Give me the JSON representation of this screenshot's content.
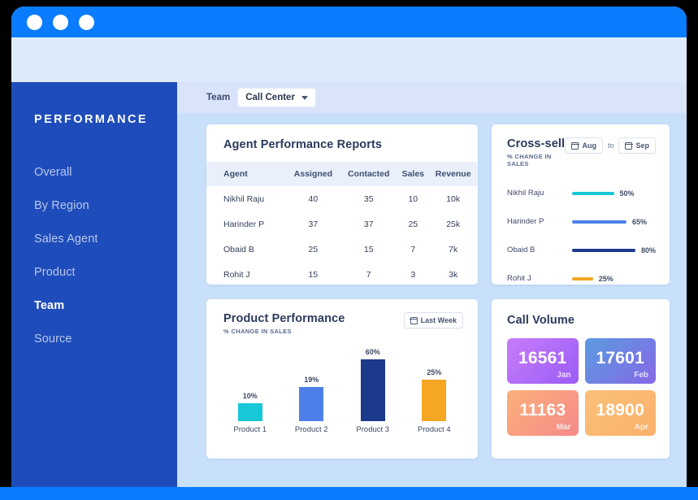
{
  "window": {
    "traffic_lights": [
      "dot-1",
      "dot-2",
      "dot-3"
    ]
  },
  "sidebar": {
    "brand": "PERFORMANCE",
    "items": [
      {
        "label": "Overall",
        "active": false
      },
      {
        "label": "By Region",
        "active": false
      },
      {
        "label": "Sales Agent",
        "active": false
      },
      {
        "label": "Product",
        "active": false
      },
      {
        "label": "Team",
        "active": true
      },
      {
        "label": "Source",
        "active": false
      }
    ]
  },
  "topbar": {
    "label": "Team",
    "select_value": "Call Center"
  },
  "agent_reports": {
    "title": "Agent Performance Reports",
    "columns": [
      "Agent",
      "Assigned",
      "Contacted",
      "Sales",
      "Revenue"
    ],
    "rows": [
      [
        "Nikhil Raju",
        "40",
        "35",
        "10",
        "10k"
      ],
      [
        "Harinder P",
        "37",
        "37",
        "25",
        "25k"
      ],
      [
        "Obaid B",
        "25",
        "15",
        "7",
        "7k"
      ],
      [
        "Rohit J",
        "15",
        "7",
        "3",
        "3k"
      ]
    ]
  },
  "cross_sell": {
    "title": "Cross-sell",
    "subtitle": "% CHANGE IN SALES",
    "range_from": "Aug",
    "range_to_label": "to",
    "range_to": "Sep",
    "chart_data": {
      "type": "bar",
      "orientation": "horizontal",
      "title": "Cross-sell",
      "xlabel": "% change in sales",
      "ylabel": "",
      "categories": [
        "Nikhil Raju",
        "Harinder P",
        "Obaid B",
        "Rohit J"
      ],
      "values": [
        50,
        65,
        80,
        25
      ],
      "labels": [
        "50%",
        "65%",
        "80%",
        "25%"
      ],
      "colors": [
        "#16c8d8",
        "#4e7fe8",
        "#1b3a8c",
        "#f5a623"
      ],
      "xlim": [
        0,
        100
      ],
      "grid": false,
      "legend": "none"
    }
  },
  "product_performance": {
    "title": "Product Performance",
    "subtitle": "% CHANGE IN SALES",
    "range_label": "Last Week",
    "chart_data": {
      "type": "bar",
      "orientation": "vertical",
      "title": "Product Performance",
      "xlabel": "",
      "ylabel": "% change in sales",
      "categories": [
        "Product 1",
        "Product 2",
        "Product 3",
        "Product 4"
      ],
      "values": [
        10,
        19,
        60,
        25
      ],
      "labels": [
        "10%",
        "19%",
        "60%",
        "25%"
      ],
      "colors": [
        "#16c8d8",
        "#4e7fe8",
        "#1b3a8c",
        "#f5a623"
      ],
      "ylim": [
        0,
        70
      ],
      "grid": false,
      "legend": "none"
    }
  },
  "call_volume": {
    "title": "Call Volume",
    "chart_data": {
      "type": "table",
      "title": "Call Volume",
      "categories": [
        "Jan",
        "Feb",
        "Mar",
        "Apr"
      ],
      "values": [
        16561,
        17601,
        11163,
        18900
      ],
      "labels": [
        "16561",
        "17601",
        "11163",
        "18900"
      ]
    },
    "tiles": [
      {
        "value": "16561",
        "month": "Jan",
        "gradient": "linear-gradient(135deg,#c77dfa 0%,#9b5cf6 100%)"
      },
      {
        "value": "17601",
        "month": "Feb",
        "gradient": "linear-gradient(135deg,#5b9be0 0%,#8668e6 100%)"
      },
      {
        "value": "11163",
        "month": "Mar",
        "gradient": "linear-gradient(135deg,#fbb07a 0%,#f58a8a 100%)"
      },
      {
        "value": "18900",
        "month": "Apr",
        "gradient": "linear-gradient(135deg,#fbc07a 0%,#fbb06a 100%)"
      }
    ]
  },
  "colors": {
    "accent": "#0a7cff",
    "sidebar": "#1e4cbb",
    "content_bg": "#c9e0fa",
    "cyan": "#16c8d8",
    "blue": "#4e7fe8",
    "navy": "#1b3a8c",
    "orange": "#f5a623"
  }
}
